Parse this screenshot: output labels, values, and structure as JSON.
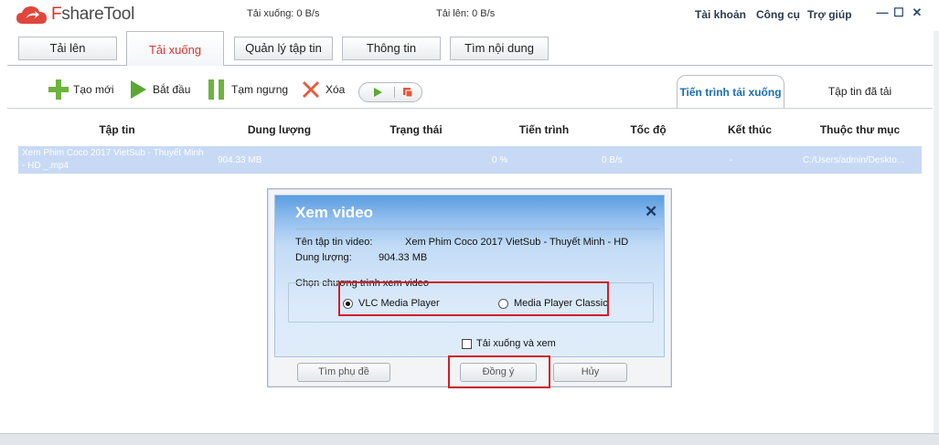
{
  "app": {
    "name_prefix": "F",
    "name_rest": "shareTool",
    "download_speed": "Tải xuống: 0 B/s",
    "upload_speed": "Tải lên: 0 B/s",
    "menu": [
      "Tài khoản",
      "Công cụ",
      "Trợ giúp"
    ],
    "window_controls": [
      "—",
      "☐",
      "✕"
    ]
  },
  "tabs": [
    {
      "label": "Tải lên"
    },
    {
      "label": "Tải xuống"
    },
    {
      "label": "Quản lý tập tin"
    },
    {
      "label": "Thông tin"
    },
    {
      "label": "Tìm nội dung"
    }
  ],
  "active_tab": "Tải xuống",
  "toolbar": {
    "new_label": "Tạo mới",
    "start_label": "Bắt đầu",
    "pause_label": "Tạm ngưng",
    "delete_label": "Xóa"
  },
  "right_tabs": {
    "progress_label": "Tiến trình tải xuống",
    "downloaded_label": "Tập tin đã tải"
  },
  "table": {
    "columns": [
      "Tập tin",
      "Dung lượng",
      "Trạng thái",
      "Tiến trình",
      "Tốc độ",
      "Kết thúc",
      "Thuộc thư mục"
    ],
    "rows": [
      {
        "file_line1": "Xem Phim Coco 2017 VietSub - Thuyết Minh",
        "file_line2": "- HD _.mp4",
        "size": "904.33 MB",
        "status": "",
        "progress": "0 %",
        "speed": "0 B/s",
        "end": "-",
        "folder": "C:/Users/admin/Deskto..."
      }
    ]
  },
  "dialog": {
    "title": "Xem video",
    "close_glyph": "✕",
    "file_name_label": "Tên tập tin video:",
    "file_name_value": "Xem Phim Coco 2017 VietSub - Thuyết Minh - HD",
    "size_label": "Dung lượng:",
    "size_value": "904.33 MB",
    "player_group_label": "Chọn chương trình xem video",
    "players": [
      {
        "label": "VLC Media Player",
        "selected": true
      },
      {
        "label": "Media Player Classic",
        "selected": false
      }
    ],
    "download_and_watch_label": "Tải xuống và xem",
    "download_and_watch_checked": false,
    "subtitle_button": "Tìm phụ đề",
    "ok_button": "Đồng ý",
    "cancel_button": "Hủy"
  },
  "colors": {
    "brand_red": "#d9342b",
    "accent_blue": "#1a6fb5",
    "highlight_red": "#d01f2a",
    "selected_row": "#c7d9f4"
  }
}
